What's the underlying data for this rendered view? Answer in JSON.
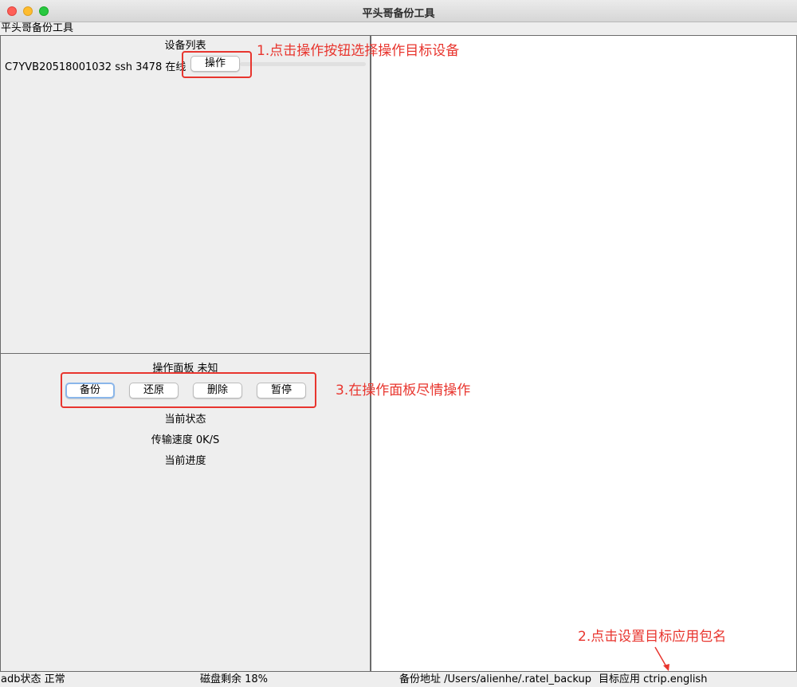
{
  "window": {
    "title": "平头哥备份工具"
  },
  "menubar": {
    "app_menu": "平头哥备份工具"
  },
  "device_panel": {
    "title": "设备列表",
    "device": {
      "info": "C7YVB20518001032 ssh 3478 在线",
      "action_label": "操作"
    }
  },
  "operation_panel": {
    "title": "操作面板 未知",
    "buttons": {
      "backup": "备份",
      "restore": "还原",
      "delete": "删除",
      "pause": "暂停"
    },
    "current_status": "当前状态",
    "transfer_speed": "传输速度  0K/S",
    "current_progress": "当前进度"
  },
  "annotations": {
    "step1": "1.点击操作按钮选择操作目标设备",
    "step2": "2.点击设置目标应用包名",
    "step3": "3.在操作面板尽情操作",
    "color": "#e8352e"
  },
  "statusbar": {
    "adb_status": "adb状态 正常",
    "disk_free": "磁盘剩余 18%",
    "backup_path": "备份地址 /Users/alienhe/.ratel_backup",
    "target_app": "目标应用 ctrip.english"
  }
}
